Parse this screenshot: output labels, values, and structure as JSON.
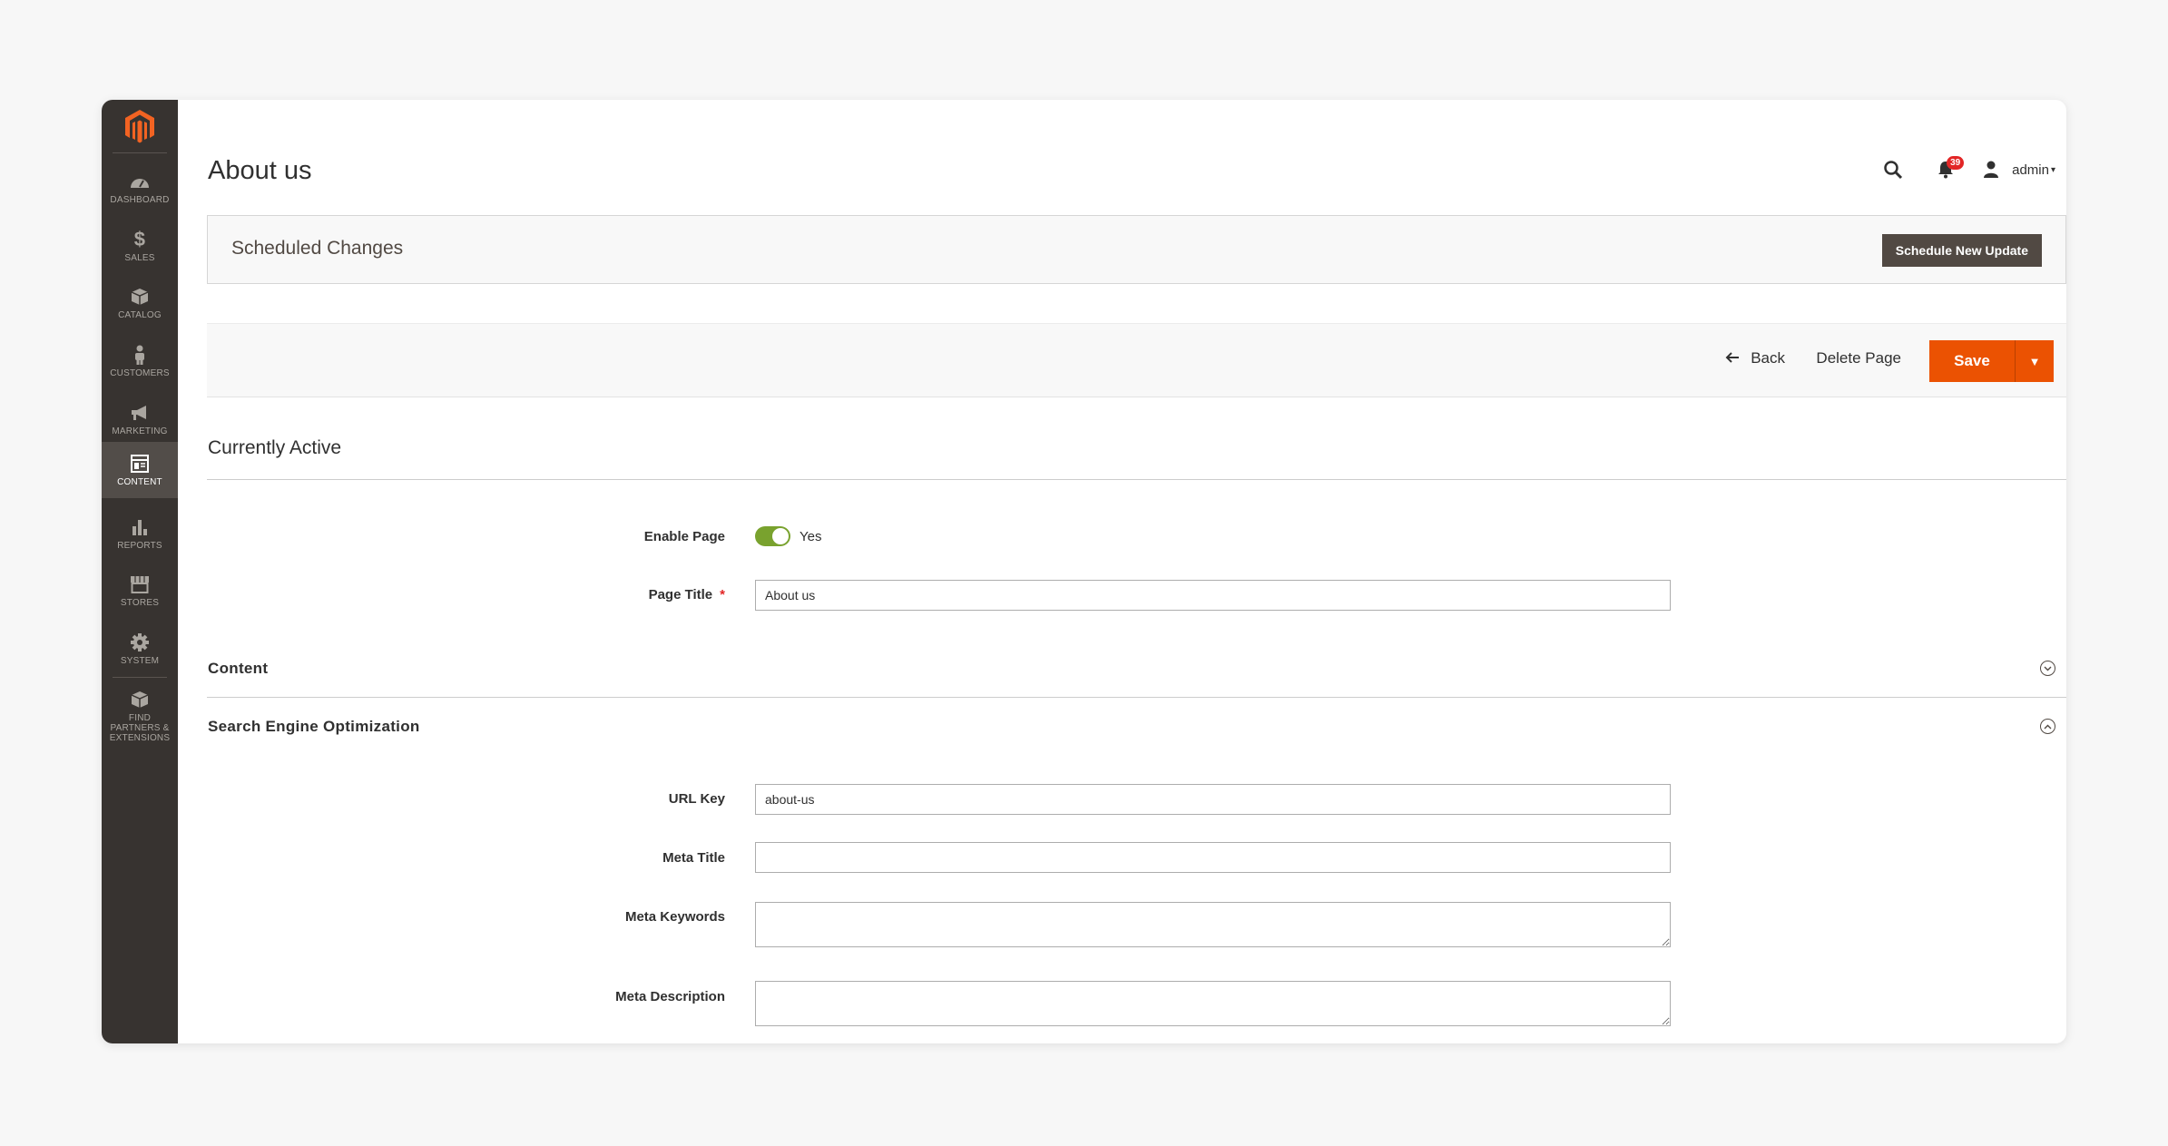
{
  "sidebar": {
    "items": [
      {
        "label": "DASHBOARD",
        "icon": "dashboard-icon"
      },
      {
        "label": "SALES",
        "icon": "dollar-icon"
      },
      {
        "label": "CATALOG",
        "icon": "box-icon"
      },
      {
        "label": "CUSTOMERS",
        "icon": "person-icon"
      },
      {
        "label": "MARKETING",
        "icon": "megaphone-icon"
      },
      {
        "label": "CONTENT",
        "icon": "layout-icon"
      },
      {
        "label": "REPORTS",
        "icon": "bar-chart-icon"
      },
      {
        "label": "STORES",
        "icon": "store-icon"
      },
      {
        "label": "SYSTEM",
        "icon": "gear-icon"
      },
      {
        "label": "FIND PARTNERS & EXTENSIONS",
        "icon": "cube-icon"
      }
    ],
    "active": "CONTENT"
  },
  "header": {
    "title": "About us",
    "notifications_count": "39",
    "user": "admin"
  },
  "scheduled": {
    "title": "Scheduled Changes",
    "button": "Schedule New Update"
  },
  "actions": {
    "back": "Back",
    "delete": "Delete Page",
    "save": "Save"
  },
  "status_section": {
    "title": "Currently Active"
  },
  "form": {
    "enable_label": "Enable Page",
    "enable_value": "Yes",
    "page_title_label": "Page Title",
    "page_title_value": "About us",
    "required_mark": "*"
  },
  "content_section": {
    "title": "Content"
  },
  "seo_section": {
    "title": "Search Engine Optimization",
    "url_key_label": "URL Key",
    "url_key_value": "about-us",
    "meta_title_label": "Meta Title",
    "meta_keywords_label": "Meta Keywords",
    "meta_description_label": "Meta Description"
  },
  "colors": {
    "sidebar": "#373330",
    "accent": "#eb5202",
    "toggle_on": "#79a22e",
    "dark_button": "#514943"
  }
}
